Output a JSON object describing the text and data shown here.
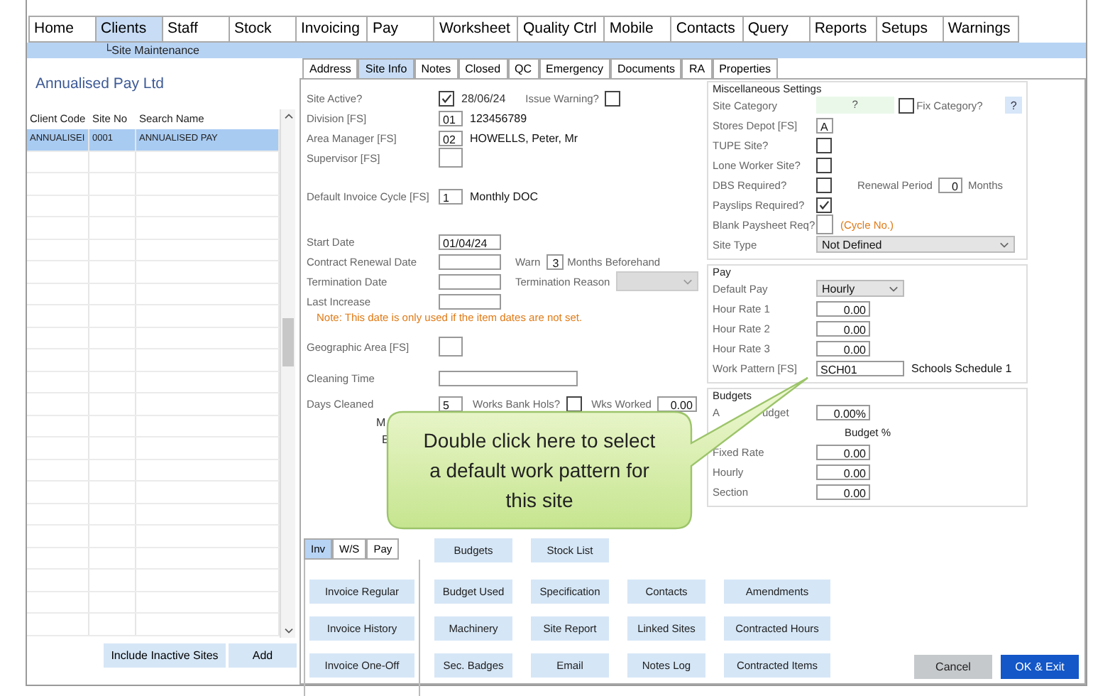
{
  "menu": [
    {
      "label": "Home",
      "selected": false
    },
    {
      "label": "Clients",
      "selected": true
    },
    {
      "label": "Staff",
      "selected": false
    },
    {
      "label": "Stock",
      "selected": false
    },
    {
      "label": "Invoicing",
      "selected": false
    },
    {
      "label": "Pay",
      "selected": false
    },
    {
      "label": "Worksheet",
      "selected": false
    },
    {
      "label": "Quality Ctrl",
      "selected": false
    },
    {
      "label": "Mobile",
      "selected": false
    },
    {
      "label": "Contacts",
      "selected": false
    },
    {
      "label": "Query",
      "selected": false
    },
    {
      "label": "Reports",
      "selected": false
    },
    {
      "label": "Setups",
      "selected": false
    },
    {
      "label": "Warnings",
      "selected": false
    }
  ],
  "breadcrumb": "└Site Maintenance",
  "client_panel": {
    "title": "Annualised Pay Ltd",
    "columns": [
      "Client Code",
      "Site No",
      "Search Name"
    ],
    "rows": [
      {
        "cells": [
          "ANNUALISEI",
          "0001",
          "ANNUALISED PAY"
        ],
        "selected": true
      }
    ],
    "buttons": [
      "Include Inactive Sites",
      "Add"
    ]
  },
  "site_tabs": [
    {
      "label": "Address",
      "selected": false
    },
    {
      "label": "Site Info",
      "selected": true
    },
    {
      "label": "Notes",
      "selected": false
    },
    {
      "label": "Closed",
      "selected": false
    },
    {
      "label": "QC",
      "selected": false
    },
    {
      "label": "Emergency",
      "selected": false
    },
    {
      "label": "Documents",
      "selected": false
    },
    {
      "label": "RA",
      "selected": false
    },
    {
      "label": "Properties",
      "selected": false
    }
  ],
  "site_info": {
    "site_active": {
      "label": "Site Active?",
      "checked": true,
      "date": "28/06/24"
    },
    "issue_warning": {
      "label": "Issue Warning?",
      "checked": false
    },
    "division": {
      "label": "Division [FS]",
      "code": "01",
      "name": "123456789"
    },
    "area_manager": {
      "label": "Area Manager [FS]",
      "code": "02",
      "name": "HOWELLS, Peter, Mr"
    },
    "supervisor": {
      "label": "Supervisor [FS]"
    },
    "invoice_cycle": {
      "label": "Default Invoice Cycle [FS]",
      "code": "1",
      "name": "Monthly DOC"
    },
    "start_date": {
      "label": "Start Date",
      "value": "01/04/24"
    },
    "contract_renewal": {
      "label": "Contract Renewal Date",
      "warn_label": "Warn",
      "warn_value": "3",
      "warn_suffix": "Months Beforehand"
    },
    "termination": {
      "label": "Termination Date",
      "reason_label": "Termination Reason",
      "reason_disabled": true
    },
    "last_increase": {
      "label": "Last Increase",
      "note": "Note: This date is only used if the item dates are not set."
    },
    "geographic_area": {
      "label": "Geographic Area [FS]"
    },
    "cleaning_time": {
      "label": "Cleaning Time"
    },
    "days_cleaned": {
      "label": "Days Cleaned",
      "value": "5",
      "bank_hols_label": "Works Bank Hols?",
      "bank_hols_checked": false,
      "weeks_label": "Wks Worked",
      "weeks_value": "0.00"
    },
    "covered_fragments": [
      "M",
      "E"
    ]
  },
  "misc": {
    "title": "Miscellaneous Settings",
    "site_category": {
      "label": "Site Category",
      "value": "?",
      "fix_label": "Fix Category?",
      "fix_checked": false,
      "help": "?"
    },
    "stores_depot": {
      "label": "Stores Depot [FS]",
      "value": "A"
    },
    "flags": [
      {
        "label": "TUPE Site?",
        "checked": false
      },
      {
        "label": "Lone Worker Site?",
        "checked": false
      },
      {
        "label": "DBS Required?",
        "checked": false,
        "extra_label": "Renewal Period",
        "extra_value": "0",
        "extra_suffix": "Months"
      },
      {
        "label": "Payslips Required?",
        "checked": true
      }
    ],
    "blank_paysheet": {
      "label": "Blank Paysheet Req?",
      "hint": "(Cycle No.)"
    },
    "site_type": {
      "label": "Site Type",
      "value": "Not Defined"
    }
  },
  "pay": {
    "title": "Pay",
    "default_pay": {
      "label": "Default Pay",
      "value": "Hourly"
    },
    "rates": [
      {
        "label": "Hour Rate 1",
        "value": "0.00"
      },
      {
        "label": "Hour Rate 2",
        "value": "0.00"
      },
      {
        "label": "Hour Rate 3",
        "value": "0.00"
      }
    ],
    "work_pattern": {
      "label": "Work Pattern [FS]",
      "code": "SCH01",
      "name": "Schools Schedule 1"
    }
  },
  "budgets": {
    "title": "Budgets",
    "annual_label_start": "A",
    "annual_label_end": "udget",
    "annual_value": "0.00%",
    "column": "Budget %",
    "rows": [
      {
        "label": "Fixed Rate",
        "value": "0.00"
      },
      {
        "label": "Hourly",
        "value": "0.00"
      },
      {
        "label": "Section",
        "value": "0.00"
      }
    ]
  },
  "callout": "Double click here to select a default work pattern for this site",
  "bottom_tabs": [
    {
      "label": "Inv",
      "selected": true
    },
    {
      "label": "W/S",
      "selected": false
    },
    {
      "label": "Pay",
      "selected": false
    }
  ],
  "inv_buttons": [
    "Invoice Regular",
    "Invoice History",
    "Invoice One-Off"
  ],
  "action_rows": [
    [
      "Budgets",
      "Stock List"
    ],
    [
      "Budget Used",
      "Specification",
      "Contacts",
      "Amendments"
    ],
    [
      "Machinery",
      "Site Report",
      "Linked Sites",
      "Contracted Hours"
    ],
    [
      "Sec. Badges",
      "Email",
      "Notes Log",
      "Contracted Items"
    ]
  ],
  "dialog_buttons": [
    {
      "label": "Cancel",
      "kind": "secondary"
    },
    {
      "label": "OK & Exit",
      "kind": "primary"
    }
  ]
}
